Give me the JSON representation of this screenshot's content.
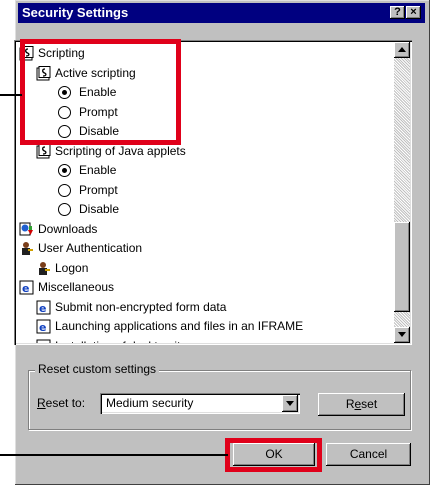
{
  "dialog": {
    "title": "Security Settings",
    "help_button": "?",
    "close_button": "×"
  },
  "tree": [
    {
      "kind": "folder",
      "icon": "scripting-icon",
      "label": "Scripting",
      "level": 0
    },
    {
      "kind": "folder",
      "icon": "scripting-icon",
      "label": "Active scripting",
      "level": 1
    },
    {
      "kind": "radio",
      "label": "Enable",
      "checked": true,
      "level": 2
    },
    {
      "kind": "radio",
      "label": "Prompt",
      "checked": false,
      "level": 2
    },
    {
      "kind": "radio",
      "label": "Disable",
      "checked": false,
      "level": 2
    },
    {
      "kind": "folder",
      "icon": "scripting-icon",
      "label": "Scripting of Java applets",
      "level": 1
    },
    {
      "kind": "radio",
      "label": "Enable",
      "checked": true,
      "level": 2
    },
    {
      "kind": "radio",
      "label": "Prompt",
      "checked": false,
      "level": 2
    },
    {
      "kind": "radio",
      "label": "Disable",
      "checked": false,
      "level": 2
    },
    {
      "kind": "folder",
      "icon": "downloads-icon",
      "label": "Downloads",
      "level": 0
    },
    {
      "kind": "folder",
      "icon": "user-auth-icon",
      "label": "User Authentication",
      "level": 0
    },
    {
      "kind": "folder",
      "icon": "user-auth-icon",
      "label": "Logon",
      "level": 1
    },
    {
      "kind": "folder",
      "icon": "ie-icon",
      "label": "Miscellaneous",
      "level": 0
    },
    {
      "kind": "folder",
      "icon": "ie-icon",
      "label": "Submit non-encrypted form data",
      "level": 1
    },
    {
      "kind": "folder",
      "icon": "ie-icon",
      "label": "Launching applications and files in an IFRAME",
      "level": 1
    },
    {
      "kind": "folder",
      "icon": "ie-icon",
      "label": "Installation of desktop items",
      "level": 1
    }
  ],
  "reset_group": {
    "legend": "Reset custom settings",
    "reset_to_label": "Reset to:",
    "reset_to_value": "Medium security",
    "reset_button": "Reset"
  },
  "buttons": {
    "ok": "OK",
    "cancel": "Cancel"
  },
  "colors": {
    "title_bar": "#000080",
    "highlight": "#e0001a",
    "face": "#c0c0c0"
  }
}
